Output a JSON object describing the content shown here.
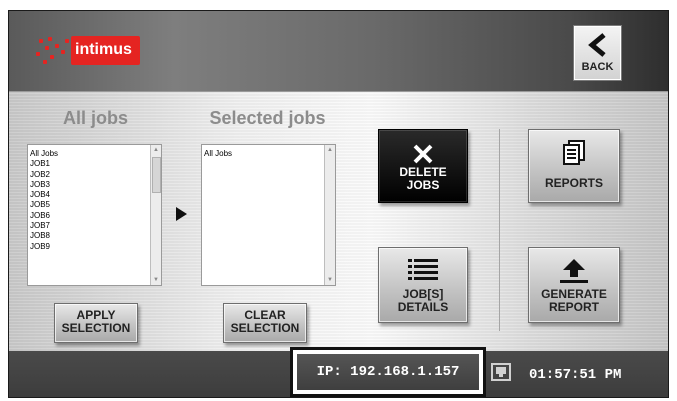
{
  "header": {
    "logo_text": "intimus",
    "back_label": "BACK"
  },
  "left_panel": {
    "all_jobs_heading": "All jobs",
    "selected_jobs_heading": "Selected jobs",
    "all_jobs_items": [
      "All Jobs",
      "JOB1",
      "JOB2",
      "JOB3",
      "JOB4",
      "JOB5",
      "JOB6",
      "JOB7",
      "JOB8",
      "JOB9"
    ],
    "selected_jobs_items": [
      "All Jobs"
    ],
    "apply_label_1": "APPLY",
    "apply_label_2": "SELECTION",
    "clear_label_1": "CLEAR",
    "clear_label_2": "SELECTION"
  },
  "actions": {
    "delete_label_1": "DELETE",
    "delete_label_2": "JOBS",
    "details_label_1": "JOB[S]",
    "details_label_2": "DETAILS",
    "reports_label": "REPORTS",
    "generate_label_1": "GENERATE",
    "generate_label_2": "REPORT"
  },
  "status": {
    "ip": "IP: 192.168.1.157",
    "time": "01:57:51 PM"
  },
  "colors": {
    "brand": "#e52421",
    "status_bar": "#444444",
    "delete_button": "#111111"
  },
  "icons": {
    "back": "chevron-left-icon",
    "delete": "close-icon",
    "details": "list-icon",
    "reports": "document-stack-icon",
    "generate": "upload-icon",
    "network": "network-icon",
    "move": "play-right-icon"
  }
}
